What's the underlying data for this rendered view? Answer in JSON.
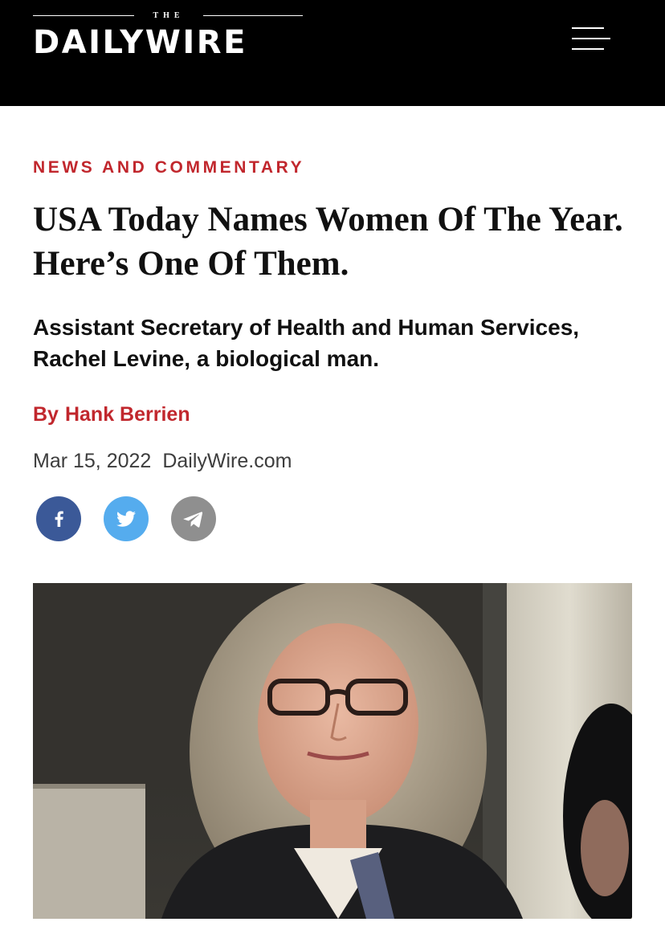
{
  "header": {
    "logo_small": "THE",
    "logo_main": "DAILYWIRE",
    "menu_icon": "hamburger-menu-icon",
    "background_color": "#000000"
  },
  "article": {
    "category": "NEWS AND COMMENTARY",
    "title": "USA Today Names Women Of The Year. Here’s One Of Them.",
    "subtitle": "Assistant Secretary of Health and Human Services, Rachel Levine, a biological man.",
    "by_label": "By",
    "author": "Hank Berrien",
    "date": "Mar 15, 2022",
    "source": "DailyWire.com",
    "accent_color": "#c1272d"
  },
  "share": [
    {
      "network": "facebook",
      "icon": "facebook-icon",
      "color": "#3b5998"
    },
    {
      "network": "twitter",
      "icon": "twitter-icon",
      "color": "#55acee"
    },
    {
      "network": "telegram",
      "icon": "telegram-icon",
      "color": "#8f8f8f"
    }
  ],
  "hero_image": {
    "subject": "portrait-photo"
  }
}
